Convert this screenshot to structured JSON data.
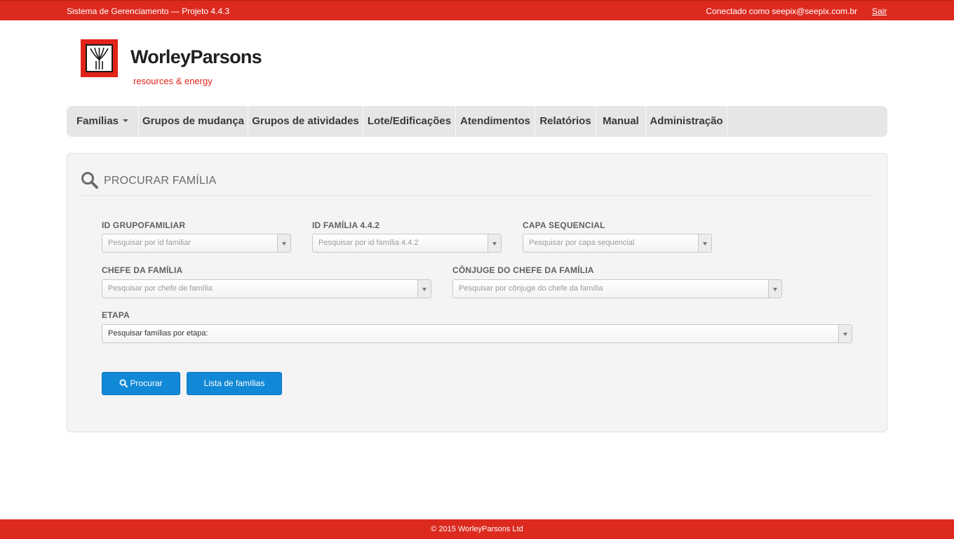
{
  "topbar": {
    "system": "Sistema de Gerenciamento — Projeto 4.4.3",
    "user": "Conectado como seepix@seepix.com.br",
    "logout": "Sair"
  },
  "logo": {
    "brand": "WorleyParsons",
    "tagline": "resources & energy",
    "colors": {
      "red": "#e2231a",
      "dark": "#231f20"
    }
  },
  "nav": {
    "items": [
      {
        "label": "Famílias",
        "dropdown": true
      },
      {
        "label": "Grupos de mudança"
      },
      {
        "label": "Grupos de atividades"
      },
      {
        "label": "Lote/Edificações"
      },
      {
        "label": "Atendimentos"
      },
      {
        "label": "Relatórios"
      },
      {
        "label": "Manual"
      },
      {
        "label": "Administração"
      }
    ]
  },
  "search": {
    "title": "PROCURAR FAMÍLIA",
    "icon": "search-icon",
    "fields": {
      "id_grupofamiliar": {
        "label": "ID GRUPOFAMILIAR",
        "placeholder": "Pesquisar por id familiar"
      },
      "id_familia": {
        "label": "ID FAMÍLIA 4.4.2",
        "placeholder": "Pesquisar por id família 4.4.2"
      },
      "capa": {
        "label": "CAPA SEQUENCIAL",
        "placeholder": "Pesquisar por capa sequencial"
      },
      "chefe": {
        "label": "CHEFE DA FAMÍLIA",
        "placeholder": "Pesquisar por chefe de família"
      },
      "conjuge": {
        "label": "CÔNJUGE DO CHEFE DA FAMÍLIA",
        "placeholder": "Pesquisar por cônjuge do chefe da família"
      },
      "etapa": {
        "label": "ETAPA",
        "value": "Pesquisar famílias por etapa:"
      }
    },
    "buttons": {
      "search": "Procurar",
      "list": "Lista de famílias"
    }
  },
  "footer": {
    "copyright": "© 2015 WorleyParsons Ltd"
  },
  "colors": {
    "topbar": "#dc2a1f",
    "button": "#1289d6",
    "panel": "#f4f4f4"
  }
}
